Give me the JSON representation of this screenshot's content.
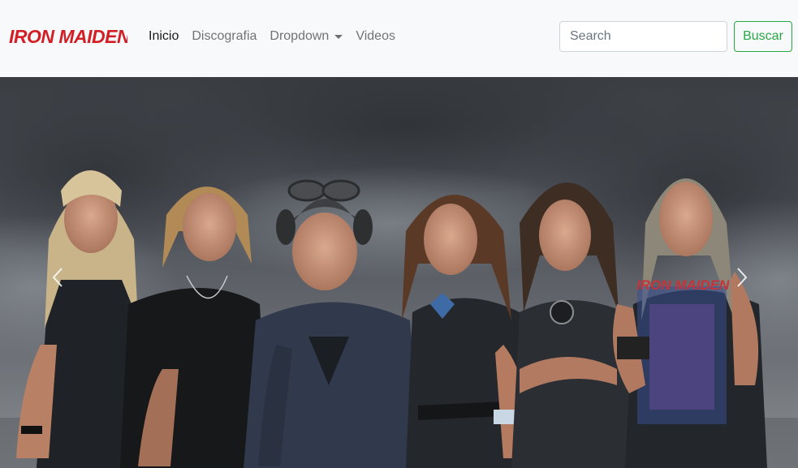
{
  "brand": {
    "logo_text": "IRON MAIDEN",
    "color": "#d21f26"
  },
  "nav": {
    "items": [
      {
        "label": "Inicio",
        "active": true
      },
      {
        "label": "Discografia",
        "active": false
      },
      {
        "label": "Dropdown",
        "active": false,
        "dropdown": true
      },
      {
        "label": "Videos",
        "active": false
      }
    ]
  },
  "search": {
    "placeholder": "Search",
    "button_label": "Buscar",
    "button_color": "#28a745"
  },
  "carousel": {
    "controls": {
      "prev_icon": "chevron-left-icon",
      "next_icon": "chevron-right-icon"
    },
    "shirt_print": "IRON MAIDEN"
  }
}
